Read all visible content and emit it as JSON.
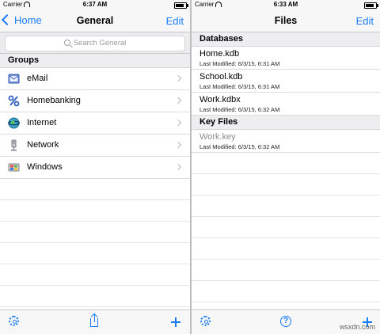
{
  "left": {
    "status": {
      "carrier": "Carrier",
      "time": "6:37 AM"
    },
    "nav": {
      "back_label": "Home",
      "title": "General",
      "edit_label": "Edit"
    },
    "search": {
      "placeholder": "Search General"
    },
    "section": "Groups",
    "groups": [
      {
        "label": "eMail",
        "icon": "email-icon"
      },
      {
        "label": "Homebanking",
        "icon": "percent-icon"
      },
      {
        "label": "Internet",
        "icon": "globe-icon"
      },
      {
        "label": "Network",
        "icon": "network-icon"
      },
      {
        "label": "Windows",
        "icon": "windows-icon"
      }
    ],
    "toolbar": [
      "gear-icon",
      "share-icon",
      "plus-icon"
    ]
  },
  "right": {
    "status": {
      "carrier": "Carrier",
      "time": "6:33 AM"
    },
    "nav": {
      "title": "Files",
      "edit_label": "Edit"
    },
    "sections": {
      "databases": "Databases",
      "keyfiles": "Key Files"
    },
    "databases": [
      {
        "name": "Home.kdb",
        "modified": "Last Modified: 6/3/15, 6:31 AM"
      },
      {
        "name": "School.kdb",
        "modified": "Last Modified: 6/3/15, 6:31 AM"
      },
      {
        "name": "Work.kdbx",
        "modified": "Last Modified: 6/3/15, 6:32 AM"
      }
    ],
    "keyfiles": [
      {
        "name": "Work.key",
        "modified": "Last Modified: 6/3/15, 6:32 AM"
      }
    ],
    "toolbar": [
      "gear-icon",
      "help-icon",
      "plus-icon"
    ]
  },
  "watermark": "wsxdn.com",
  "colors": {
    "accent": "#1a7cf8",
    "separator": "#c8c7cc"
  }
}
